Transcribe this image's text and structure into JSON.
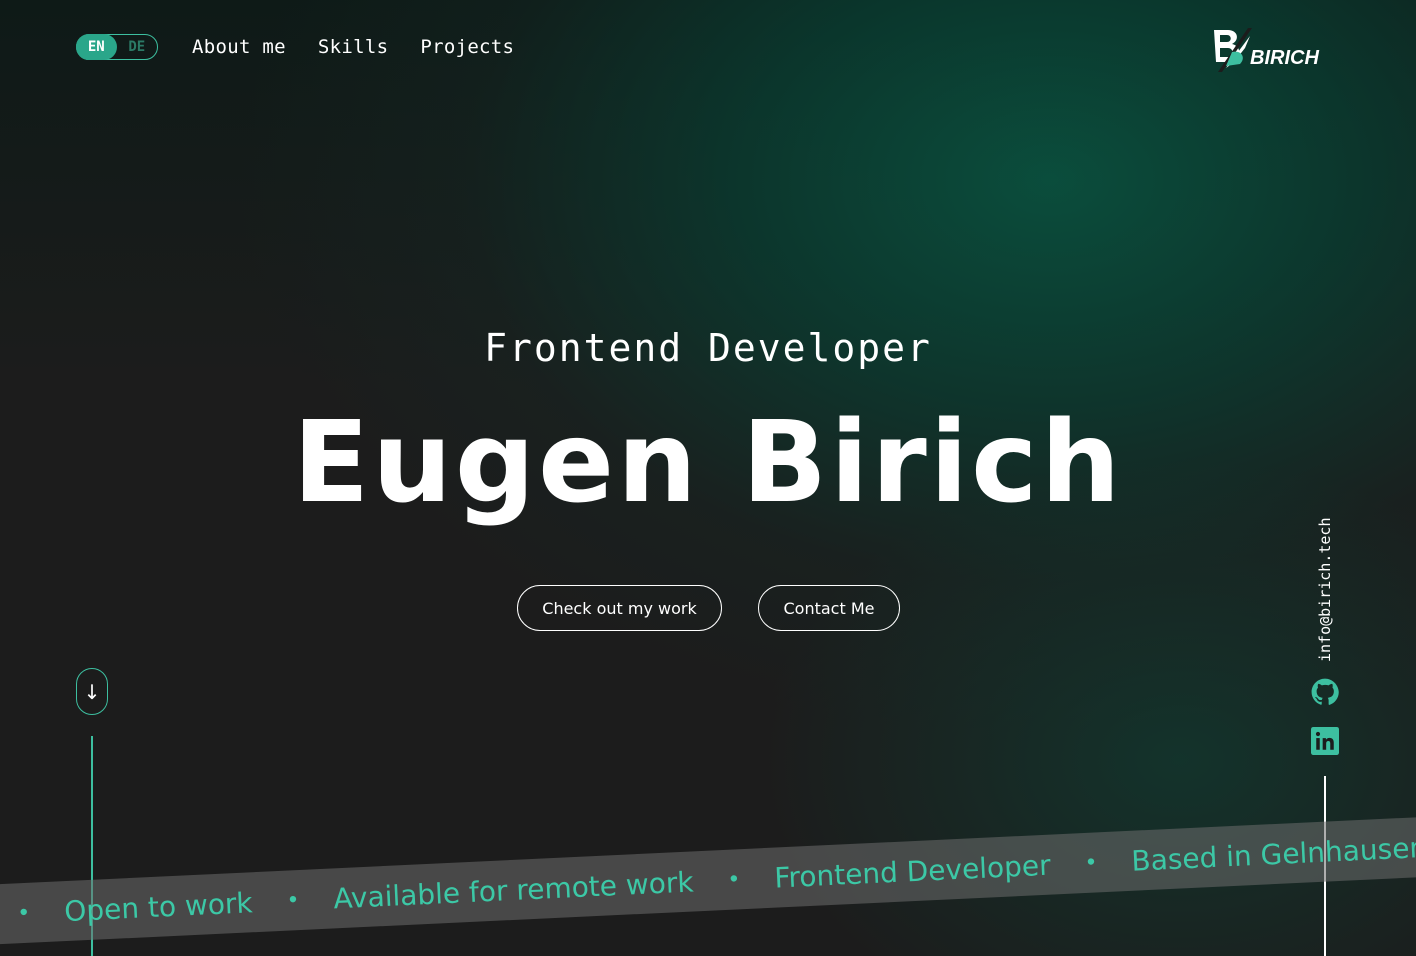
{
  "header": {
    "lang": {
      "active": "EN",
      "inactive": "DE"
    },
    "nav": [
      {
        "label": "About me"
      },
      {
        "label": "Skills"
      },
      {
        "label": "Projects"
      }
    ],
    "logo_text": "BIRICH"
  },
  "hero": {
    "subtitle": "Frontend Developer",
    "title": "Eugen Birich",
    "buttons": {
      "work": "Check out my work",
      "contact": "Contact Me"
    }
  },
  "scroll": {
    "icon": "arrow-down-icon",
    "glyph": "↓"
  },
  "contact_rail": {
    "email": "info@birich.tech",
    "icons": [
      "github-icon",
      "linkedin-icon"
    ]
  },
  "ribbon": {
    "items": [
      "Open to work",
      "Available for remote work",
      "Frontend Developer",
      "Based in Gelnhausen"
    ],
    "separator": "•"
  },
  "colors": {
    "accent": "#3dbfa0",
    "accent_dark": "#2aa68a",
    "background": "#1c1c1c",
    "gradient_green": "#0a503e"
  }
}
